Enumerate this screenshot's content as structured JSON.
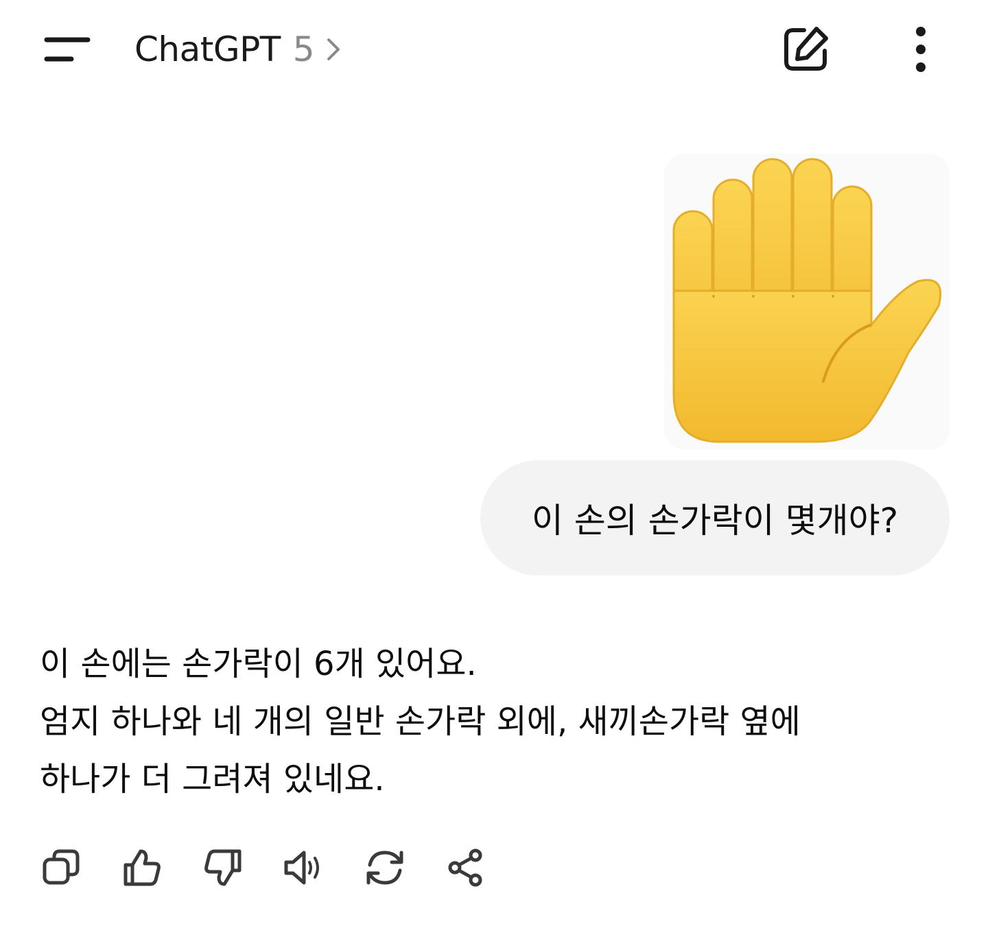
{
  "header": {
    "title": "ChatGPT",
    "version": "5",
    "icons": {
      "menu": "menu-icon",
      "chevron": "chevron-right-icon",
      "new_chat": "edit-icon",
      "more": "more-vertical-icon"
    }
  },
  "conversation": {
    "user": {
      "image": "raised-hand-emoji",
      "message": "이 손의 손가락이 몇개야?"
    },
    "assistant": {
      "lines": [
        "이 손에는 손가락이 6개 있어요.",
        "엄지 하나와 네 개의 일반 손가락 외에, 새끼손가락 옆에",
        "하나가 더 그려져 있네요."
      ]
    }
  },
  "actions": [
    "copy-icon",
    "thumbs-up-icon",
    "thumbs-down-icon",
    "speaker-icon",
    "regenerate-icon",
    "share-icon"
  ],
  "colors": {
    "text": "#0d0d0d",
    "muted": "#8a8a8a",
    "bubble": "#f3f3f3",
    "icon": "#3a3a3a",
    "hand_fill": "#f7c73d",
    "hand_shade": "#e0a820"
  }
}
